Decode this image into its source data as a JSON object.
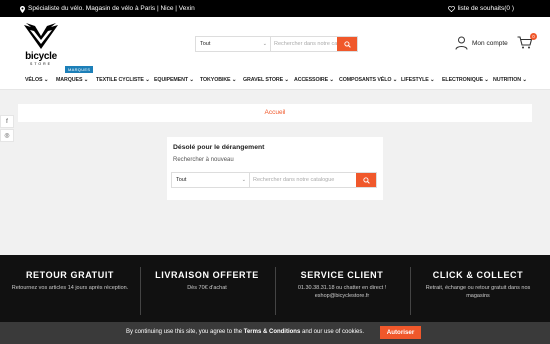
{
  "topbar": {
    "tagline": "Spécialiste du vélo. Magasin de vélo à Paris | Nice | Vexin",
    "wishlist": "liste de souhaits(0 )"
  },
  "logo": {
    "brand": "bicycle",
    "sub": "STORE"
  },
  "search": {
    "category": "Tout",
    "placeholder": "Rechercher dans notre catalogue"
  },
  "account": {
    "label": "Mon compte"
  },
  "cart": {
    "count": "0"
  },
  "nav": {
    "badge": "MARQUES",
    "items": [
      {
        "label": "VÉLOS"
      },
      {
        "label": "MARQUES"
      },
      {
        "label": "TEXTILE CYCLISTE"
      },
      {
        "label": "EQUIPEMENT"
      },
      {
        "label": "TOKYOBIKE"
      },
      {
        "label": "GRAVEL STORE"
      },
      {
        "label": "ACCESSOIRE"
      },
      {
        "label": "COMPOSANTS VÉLO"
      },
      {
        "label": "LIFESTYLE"
      },
      {
        "label": "ELECTRONIQUE"
      },
      {
        "label": "NUTRITION"
      }
    ]
  },
  "breadcrumb": {
    "home": "Accueil"
  },
  "error": {
    "title": "Désolé pour le dérangement",
    "text": "Rechercher à nouveau",
    "search_category": "Tout",
    "search_placeholder": "Rechercher dans notre catalogue"
  },
  "social": [
    {
      "icon": "facebook-icon",
      "glyph": "f"
    },
    {
      "icon": "instagram-icon",
      "glyph": "◎"
    }
  ],
  "footer": {
    "columns": [
      {
        "title": "RETOUR GRATUIT",
        "desc": "Retournez vos articles 14 jours après réception."
      },
      {
        "title": "LIVRAISON OFFERTE",
        "desc": "Dès 70€ d'achat"
      },
      {
        "title": "SERVICE CLIENT",
        "desc": "01.30.38.31.18 ou chatter en direct ! eshop@bicyclestore.fr"
      },
      {
        "title": "CLICK & COLLECT",
        "desc": "Retrait, échange ou retour gratuit dans nos magasins"
      }
    ]
  },
  "cookie": {
    "prefix": "By continuing use this site, you agree to the ",
    "link": "Terms & Conditions",
    "suffix": " and our use of cookies.",
    "button": "Autoriser"
  },
  "colors": {
    "accent": "#f0582b",
    "badge": "#1c7fb8",
    "footer": "#111111"
  }
}
